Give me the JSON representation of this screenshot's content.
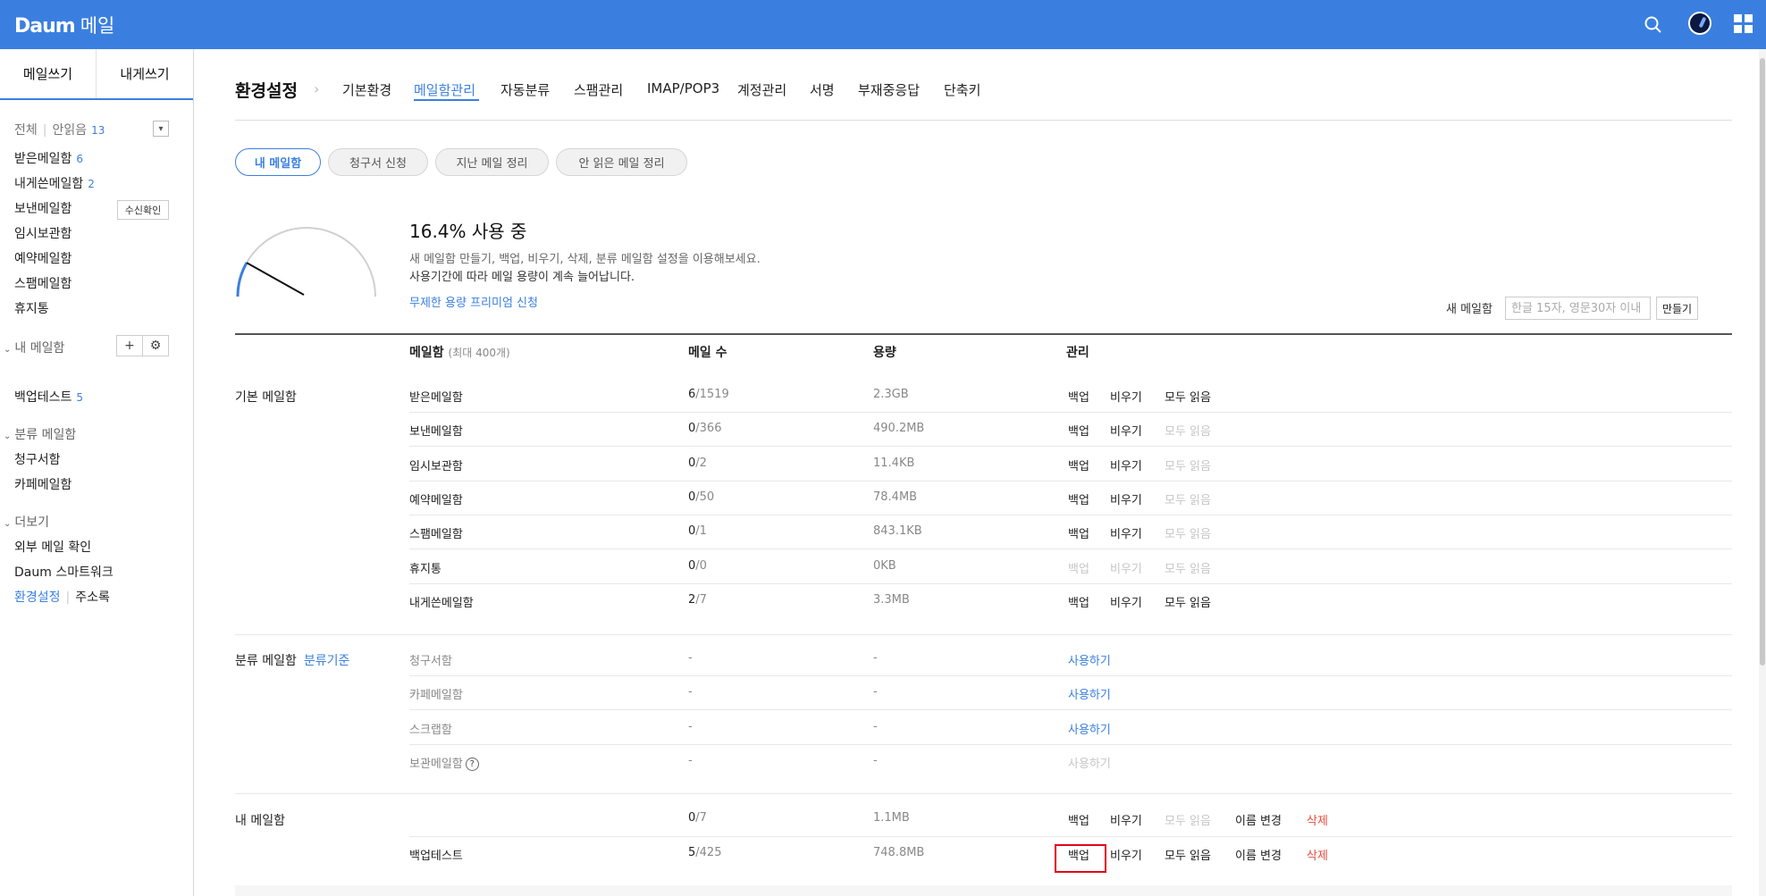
{
  "header": {
    "logo": "Daum",
    "app_name": "메일",
    "icons": [
      "search-icon",
      "avatar",
      "apps-grid-icon"
    ]
  },
  "sidebar": {
    "write_button": "메일쓰기",
    "self_write_button": "내게쓰기",
    "all_label": "전체",
    "unread_label": "안읽음",
    "unread_count": "13",
    "folders": [
      {
        "label": "받은메일함",
        "count": "6"
      },
      {
        "label": "내게쓴메일함",
        "count": "2"
      },
      {
        "label": "보낸메일함",
        "count": ""
      },
      {
        "label": "임시보관함",
        "count": ""
      },
      {
        "label": "예약메일함",
        "count": ""
      },
      {
        "label": "스팸메일함",
        "count": ""
      },
      {
        "label": "휴지통",
        "count": ""
      }
    ],
    "read_receipt_button": "수신확인",
    "my_mailbox_header": "내 메일함",
    "my_mailboxes": [
      {
        "label": "백업테스트",
        "count": "5"
      }
    ],
    "category_header": "분류 메일함",
    "categories": [
      "청구서함",
      "카페메일함"
    ],
    "more_header": "더보기",
    "more_items": [
      "외부 메일 확인",
      "Daum 스마트워크"
    ],
    "settings_link": "환경설정",
    "addressbook_link": "주소록"
  },
  "settings": {
    "title": "환경설정",
    "tabs": [
      "기본환경",
      "메일함관리",
      "자동분류",
      "스팸관리",
      "IMAP/POP3",
      "계정관리",
      "서명",
      "부재중응답",
      "단축키"
    ],
    "active_tab": "메일함관리",
    "subtabs": [
      "내 메일함",
      "청구서 신청",
      "지난 메일 정리",
      "안 읽은 메일 정리"
    ]
  },
  "usage": {
    "percent": 16.4,
    "title": "16.4% 사용 중",
    "desc1": "새 메일함 만들기, 백업, 비우기, 삭제, 분류 메일함 설정을 이용해보세요.",
    "desc2": "사용기간에 따라 메일 용량이 계속 늘어납니다.",
    "premium_link": "무제한 용량 프리미엄 신청"
  },
  "new_mailbox": {
    "label": "새 메일함",
    "placeholder": "한글 15자, 영문30자 이내",
    "button": "만들기"
  },
  "table": {
    "headers": {
      "name": "메일함",
      "name_note": "(최대 400개)",
      "count": "메일 수",
      "size": "용량",
      "manage": "관리"
    },
    "groups": {
      "basic": "기본 메일함",
      "category": "분류 메일함",
      "category_link": "분류기준",
      "mine": "내 메일함"
    },
    "basic_rows": [
      {
        "name": "받은메일함",
        "unread": "6",
        "total": "/1519",
        "size": "2.3GB",
        "backup": "백업",
        "empty": "비우기",
        "readall": "모두 읽음"
      },
      {
        "name": "보낸메일함",
        "unread": "0",
        "total": "/366",
        "size": "490.2MB",
        "backup": "백업",
        "empty": "비우기",
        "readall": "모두 읽음"
      },
      {
        "name": "임시보관함",
        "unread": "0",
        "total": "/2",
        "size": "11.4KB",
        "backup": "백업",
        "empty": "비우기",
        "readall": "모두 읽음"
      },
      {
        "name": "예약메일함",
        "unread": "0",
        "total": "/50",
        "size": "78.4MB",
        "backup": "백업",
        "empty": "비우기",
        "readall": "모두 읽음"
      },
      {
        "name": "스팸메일함",
        "unread": "0",
        "total": "/1",
        "size": "843.1KB",
        "backup": "백업",
        "empty": "비우기",
        "readall": "모두 읽음"
      },
      {
        "name": "휴지통",
        "unread": "0",
        "total": "/0",
        "size": "0KB",
        "backup": "백업",
        "empty": "비우기",
        "readall": "모두 읽음"
      },
      {
        "name": "내게쓴메일함",
        "unread": "2",
        "total": "/7",
        "size": "3.3MB",
        "backup": "백업",
        "empty": "비우기",
        "readall": "모두 읽음"
      }
    ],
    "category_rows": [
      {
        "name": "청구서함",
        "count": "-",
        "size": "-",
        "action": "사용하기"
      },
      {
        "name": "카페메일함",
        "count": "-",
        "size": "-",
        "action": "사용하기"
      },
      {
        "name": "스크랩함",
        "count": "-",
        "size": "-",
        "action": "사용하기"
      },
      {
        "name": "보관메일함",
        "count": "-",
        "size": "-",
        "action": "사용하기"
      }
    ],
    "mine_summary": {
      "unread": "0",
      "total": "/7",
      "size": "1.1MB",
      "backup": "백업",
      "empty": "비우기",
      "readall": "모두 읽음",
      "rename": "이름 변경",
      "delete": "삭제"
    },
    "mine_rows": [
      {
        "name": "백업테스트",
        "unread": "5",
        "total": "/425",
        "size": "748.8MB",
        "backup": "백업",
        "empty": "비우기",
        "readall": "모두 읽음",
        "rename": "이름 변경",
        "delete": "삭제"
      }
    ]
  },
  "colors": {
    "brand": "#3a7fe0",
    "danger": "#e84b3c",
    "highlight": "#e3001b"
  }
}
